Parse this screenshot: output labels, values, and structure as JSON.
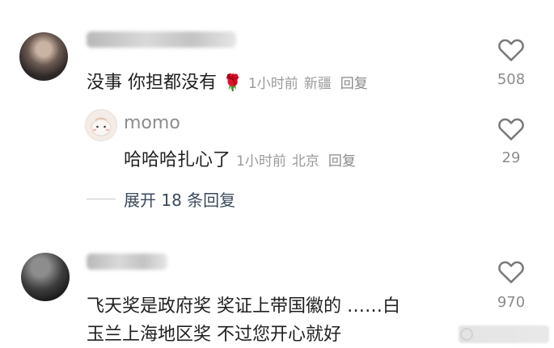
{
  "comments": [
    {
      "text": "没事 你担都没有",
      "emoji": "🌹",
      "time": "1小时前",
      "location": "新疆",
      "reply_label": "回复",
      "likes": "508"
    },
    {
      "username": "momo",
      "text": "哈哈哈扎心了",
      "time": "1小时前",
      "location": "北京",
      "reply_label": "回复",
      "likes": "29"
    },
    {
      "text_line1": "飞天奖是政府奖 奖证上带国徽的 ……白",
      "text_line2": "玉兰上海地区奖 不过您开心就好",
      "likes": "970"
    }
  ],
  "expand_label": "展开 18 条回复",
  "icons": {
    "like": "heart-outline-icon",
    "emoji": "rose-emoji"
  },
  "colors": {
    "accent_text": "#3b4a5c",
    "meta": "#9a9a9a"
  }
}
